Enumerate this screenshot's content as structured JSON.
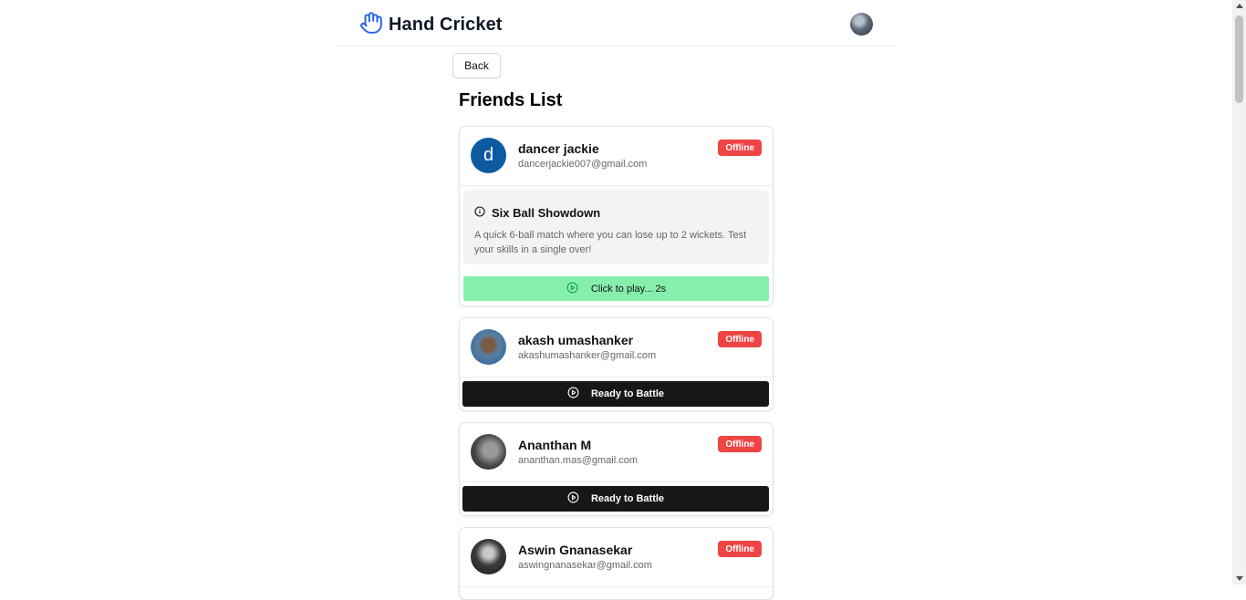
{
  "app": {
    "title": "Hand Cricket"
  },
  "nav": {
    "back_label": "Back"
  },
  "page": {
    "title": "Friends List"
  },
  "colors": {
    "offline": "#ef4444",
    "play_green": "#86efac",
    "battle_dark": "#171717",
    "brand_blue": "#2563eb"
  },
  "friends": [
    {
      "name": "dancer jackie",
      "email": "dancerjackie007@gmail.com",
      "status": "Offline",
      "avatar_letter": "d",
      "game": {
        "title": "Six Ball Showdown",
        "description": "A quick 6-ball match where you can lose up to 2 wickets. Test your skills in a single over!",
        "play_label": "Click to play... 2s"
      }
    },
    {
      "name": "akash umashanker",
      "email": "akashumashanker@gmail.com",
      "status": "Offline",
      "action_label": "Ready to Battle"
    },
    {
      "name": "Ananthan M",
      "email": "ananthan.mas@gmail.com",
      "status": "Offline",
      "action_label": "Ready to Battle"
    },
    {
      "name": "Aswin Gnanasekar",
      "email": "aswingnanasekar@gmail.com",
      "status": "Offline"
    }
  ]
}
